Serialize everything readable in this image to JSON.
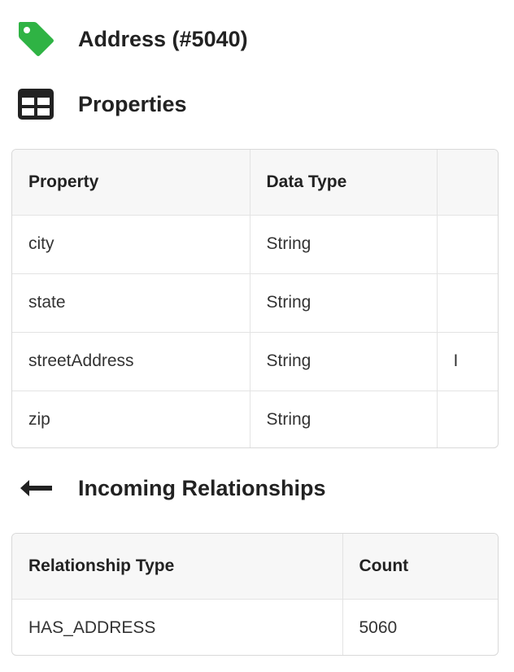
{
  "node": {
    "title": "Address (#5040)",
    "icon": "tag-icon",
    "icon_color": "#2fb344"
  },
  "properties": {
    "title": "Properties",
    "icon": "table-icon",
    "columns": [
      "Property",
      "Data Type",
      ""
    ],
    "rows": [
      {
        "property": "city",
        "type": "String",
        "extra": ""
      },
      {
        "property": "state",
        "type": "String",
        "extra": ""
      },
      {
        "property": "streetAddress",
        "type": "String",
        "extra": "I"
      },
      {
        "property": "zip",
        "type": "String",
        "extra": ""
      }
    ]
  },
  "incoming": {
    "title": "Incoming Relationships",
    "icon": "arrow-left-icon",
    "columns": [
      "Relationship Type",
      "Count"
    ],
    "rows": [
      {
        "type": "HAS_ADDRESS",
        "count": "5060"
      }
    ]
  }
}
